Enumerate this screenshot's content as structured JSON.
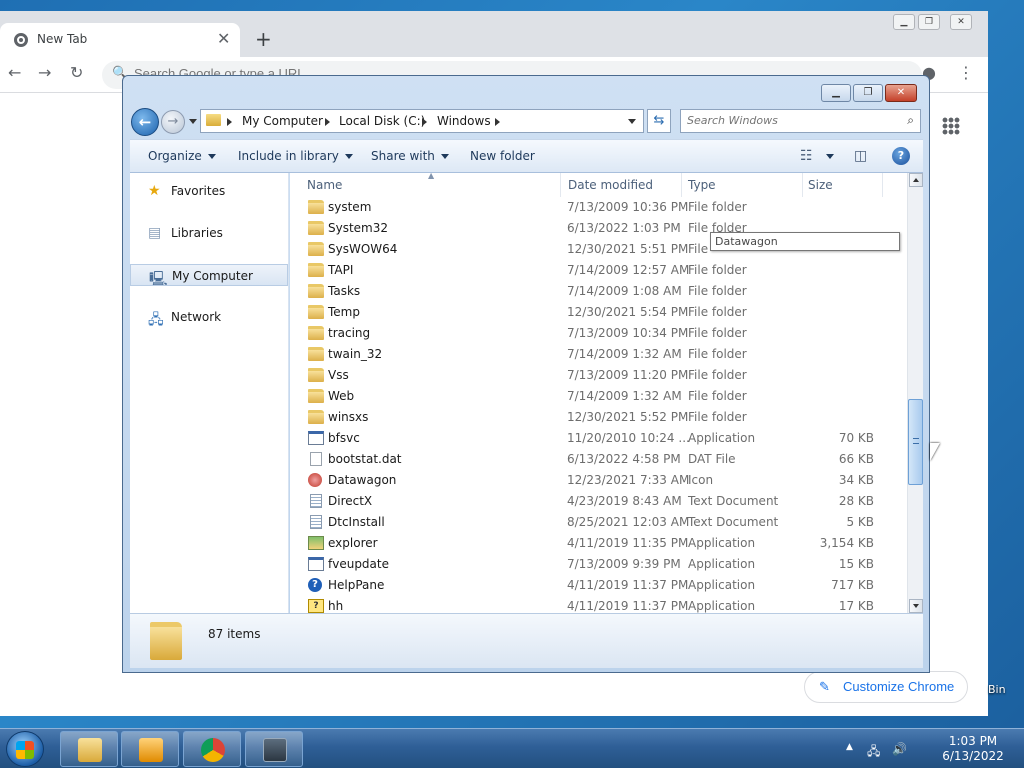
{
  "chrome": {
    "tab_title": "New Tab",
    "omnibox_placeholder": "Search Google or type a URL",
    "customize_label": "Customize Chrome"
  },
  "desktop": {
    "bin_label": "Bin"
  },
  "explorer": {
    "breadcrumb": [
      "My Computer",
      "Local Disk (C:)",
      "Windows"
    ],
    "search_placeholder": "Search Windows",
    "commands": {
      "organize": "Organize",
      "include": "Include in library",
      "share": "Share with",
      "new_folder": "New folder"
    },
    "nav": [
      {
        "label": "Favorites",
        "icon": "star-icon"
      },
      {
        "label": "Libraries",
        "icon": "library-icon"
      },
      {
        "label": "My Computer",
        "icon": "computer-icon"
      },
      {
        "label": "Network",
        "icon": "network-icon"
      }
    ],
    "columns": {
      "name": "Name",
      "date": "Date modified",
      "type": "Type",
      "size": "Size"
    },
    "files": [
      {
        "name": "system",
        "date": "7/13/2009 10:36 PM",
        "type": "File folder",
        "size": "",
        "icon": "folder"
      },
      {
        "name": "System32",
        "date": "6/13/2022 1:03 PM",
        "type": "File folder",
        "size": "",
        "icon": "folder"
      },
      {
        "name": "SysWOW64",
        "date": "12/30/2021 5:51 PM",
        "type": "File",
        "size": "",
        "icon": "folder"
      },
      {
        "name": "TAPI",
        "date": "7/14/2009 12:57 AM",
        "type": "File folder",
        "size": "",
        "icon": "folder"
      },
      {
        "name": "Tasks",
        "date": "7/14/2009 1:08 AM",
        "type": "File folder",
        "size": "",
        "icon": "folder"
      },
      {
        "name": "Temp",
        "date": "12/30/2021 5:54 PM",
        "type": "File folder",
        "size": "",
        "icon": "folder"
      },
      {
        "name": "tracing",
        "date": "7/13/2009 10:34 PM",
        "type": "File folder",
        "size": "",
        "icon": "folder"
      },
      {
        "name": "twain_32",
        "date": "7/14/2009 1:32 AM",
        "type": "File folder",
        "size": "",
        "icon": "folder"
      },
      {
        "name": "Vss",
        "date": "7/13/2009 11:20 PM",
        "type": "File folder",
        "size": "",
        "icon": "folder"
      },
      {
        "name": "Web",
        "date": "7/14/2009 1:32 AM",
        "type": "File folder",
        "size": "",
        "icon": "folder"
      },
      {
        "name": "winsxs",
        "date": "12/30/2021 5:52 PM",
        "type": "File folder",
        "size": "",
        "icon": "folder"
      },
      {
        "name": "bfsvc",
        "date": "11/20/2010 10:24 ...",
        "type": "Application",
        "size": "70 KB",
        "icon": "app"
      },
      {
        "name": "bootstat.dat",
        "date": "6/13/2022 4:58 PM",
        "type": "DAT File",
        "size": "66 KB",
        "icon": "file"
      },
      {
        "name": "Datawagon",
        "date": "12/23/2021 7:33 AM",
        "type": "Icon",
        "size": "34 KB",
        "icon": "round"
      },
      {
        "name": "DirectX",
        "date": "4/23/2019 8:43 AM",
        "type": "Text Document",
        "size": "28 KB",
        "icon": "doc"
      },
      {
        "name": "DtcInstall",
        "date": "8/25/2021 12:03 AM",
        "type": "Text Document",
        "size": "5 KB",
        "icon": "doc"
      },
      {
        "name": "explorer",
        "date": "4/11/2019 11:35 PM",
        "type": "Application",
        "size": "3,154 KB",
        "icon": "explorer"
      },
      {
        "name": "fveupdate",
        "date": "7/13/2009 9:39 PM",
        "type": "Application",
        "size": "15 KB",
        "icon": "app"
      },
      {
        "name": "HelpPane",
        "date": "4/11/2019 11:37 PM",
        "type": "Application",
        "size": "717 KB",
        "icon": "help"
      },
      {
        "name": "hh",
        "date": "4/11/2019 11:37 PM",
        "type": "Application",
        "size": "17 KB",
        "icon": "hh"
      }
    ],
    "tooltip": "Datawagon",
    "item_count": "87 items"
  },
  "taskbar": {
    "time": "1:03 PM",
    "date": "6/13/2022"
  }
}
